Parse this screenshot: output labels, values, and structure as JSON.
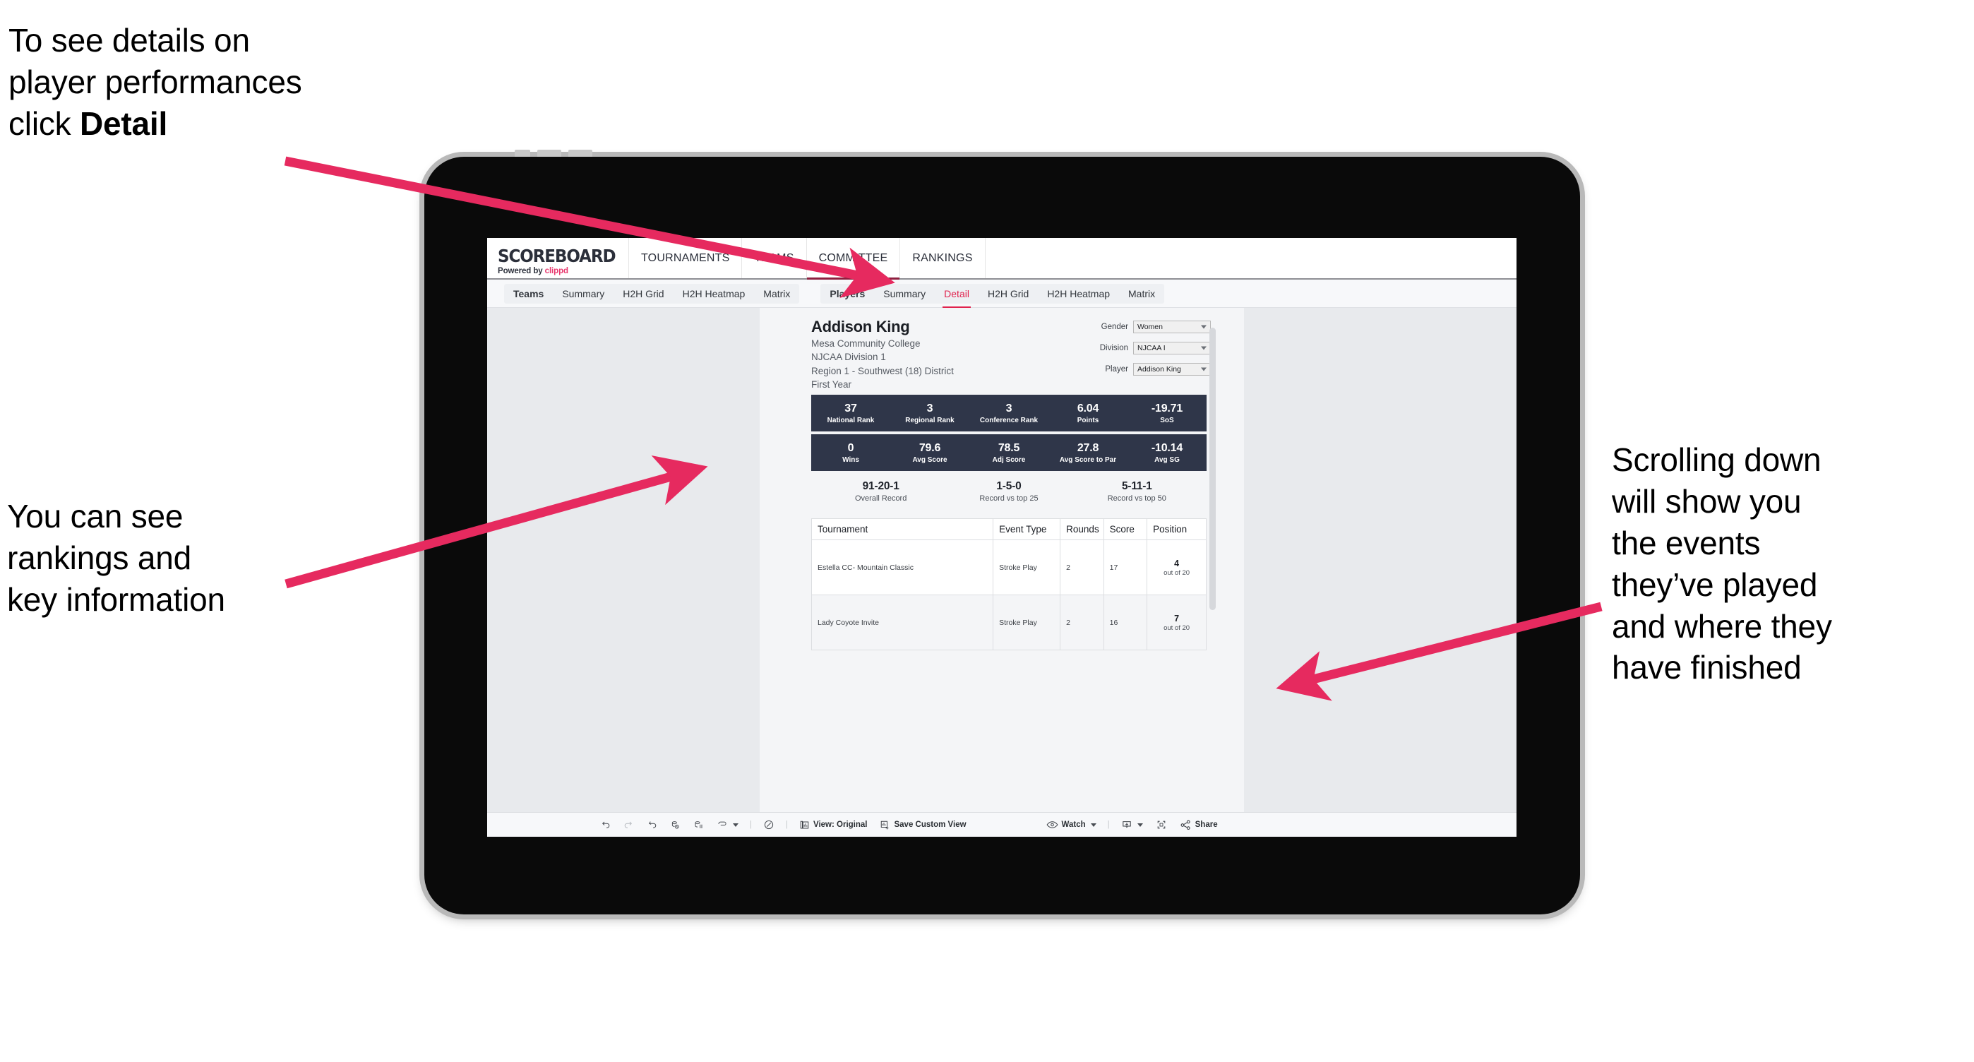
{
  "annotations": {
    "detail": "To see details on\nplayer performances\nclick ",
    "detail_bold": "Detail",
    "rankings": "You can see\nrankings and\nkey information",
    "scrolling": "Scrolling down\nwill show you\nthe events\nthey’ve played\nand where they\nhave finished"
  },
  "brand": {
    "title": "SCOREBOARD",
    "powered_prefix": "Powered by ",
    "powered_name": "clippd"
  },
  "main_nav": [
    {
      "label": "TOURNAMENTS",
      "active": false
    },
    {
      "label": "TEAMS",
      "active": false
    },
    {
      "label": "COMMITTEE",
      "active": true
    },
    {
      "label": "RANKINGS",
      "active": false
    }
  ],
  "sub_nav": {
    "teams_group": [
      {
        "label": "Teams",
        "head": true,
        "active": false
      },
      {
        "label": "Summary",
        "head": false,
        "active": false
      },
      {
        "label": "H2H Grid",
        "head": false,
        "active": false
      },
      {
        "label": "H2H Heatmap",
        "head": false,
        "active": false
      },
      {
        "label": "Matrix",
        "head": false,
        "active": false
      }
    ],
    "players_group": [
      {
        "label": "Players",
        "head": true,
        "active": false
      },
      {
        "label": "Summary",
        "head": false,
        "active": false
      },
      {
        "label": "Detail",
        "head": false,
        "active": true
      },
      {
        "label": "H2H Grid",
        "head": false,
        "active": false
      },
      {
        "label": "H2H Heatmap",
        "head": false,
        "active": false
      },
      {
        "label": "Matrix",
        "head": false,
        "active": false
      }
    ]
  },
  "player": {
    "name": "Addison King",
    "school": "Mesa Community College",
    "division": "NJCAA Division 1",
    "region": "Region 1 - Southwest (18) District",
    "year": "First Year"
  },
  "selectors": [
    {
      "label": "Gender",
      "value": "Women"
    },
    {
      "label": "Division",
      "value": "NJCAA I"
    },
    {
      "label": "Player",
      "value": "Addison King"
    }
  ],
  "stats_row_1": [
    {
      "value": "37",
      "label": "National Rank"
    },
    {
      "value": "3",
      "label": "Regional Rank"
    },
    {
      "value": "3",
      "label": "Conference Rank"
    },
    {
      "value": "6.04",
      "label": "Points"
    },
    {
      "value": "-19.71",
      "label": "SoS"
    }
  ],
  "stats_row_2": [
    {
      "value": "0",
      "label": "Wins"
    },
    {
      "value": "79.6",
      "label": "Avg Score"
    },
    {
      "value": "78.5",
      "label": "Adj Score"
    },
    {
      "value": "27.8",
      "label": "Avg Score to Par"
    },
    {
      "value": "-10.14",
      "label": "Avg SG"
    }
  ],
  "records": [
    {
      "value": "91-20-1",
      "label": "Overall Record"
    },
    {
      "value": "1-5-0",
      "label": "Record vs top 25"
    },
    {
      "value": "5-11-1",
      "label": "Record vs top 50"
    }
  ],
  "events_table": {
    "headers": [
      "Tournament",
      "Event Type",
      "Rounds",
      "Score",
      "Position"
    ],
    "rows": [
      {
        "tournament": "Estella CC- Mountain Classic",
        "event_type": "Stroke Play",
        "rounds": "2",
        "score": "17",
        "position": "4",
        "position_out_of": "out of 20"
      },
      {
        "tournament": "Lady Coyote Invite",
        "event_type": "Stroke Play",
        "rounds": "2",
        "score": "16",
        "position": "7",
        "position_out_of": "out of 20"
      }
    ]
  },
  "toolbar": {
    "view_label": "View: Original",
    "save_label": "Save Custom View",
    "watch_label": "Watch",
    "share_label": "Share"
  },
  "colors": {
    "accent_pink": "#e8386e",
    "arrow_pink": "#e62a5f",
    "stat_bar": "#2f3649",
    "active_tab": "#e0234e"
  }
}
